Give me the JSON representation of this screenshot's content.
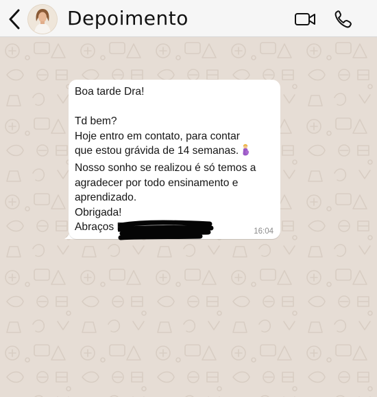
{
  "header": {
    "contact_name": "Depoimento",
    "back_icon": "chevron-left-icon",
    "video_icon": "video-camera-icon",
    "call_icon": "phone-icon",
    "background": "#f6f6f6"
  },
  "chat": {
    "wallpaper_color": "#e6ddd5",
    "message": {
      "lines": [
        "Boa tarde Dra!",
        "",
        "Td bem?",
        "Hoje entro em contato, para contar",
        "que estou grávida de 14 semanas.",
        "Nosso sonho se realizou é só temos a",
        "agradecer por todo ensinamento e",
        "aprendizado.",
        "Obrigada!",
        "Abraços E"
      ],
      "emoji": "pregnant-woman-emoji",
      "time": "16:04",
      "bubble_color": "#ffffff"
    }
  }
}
